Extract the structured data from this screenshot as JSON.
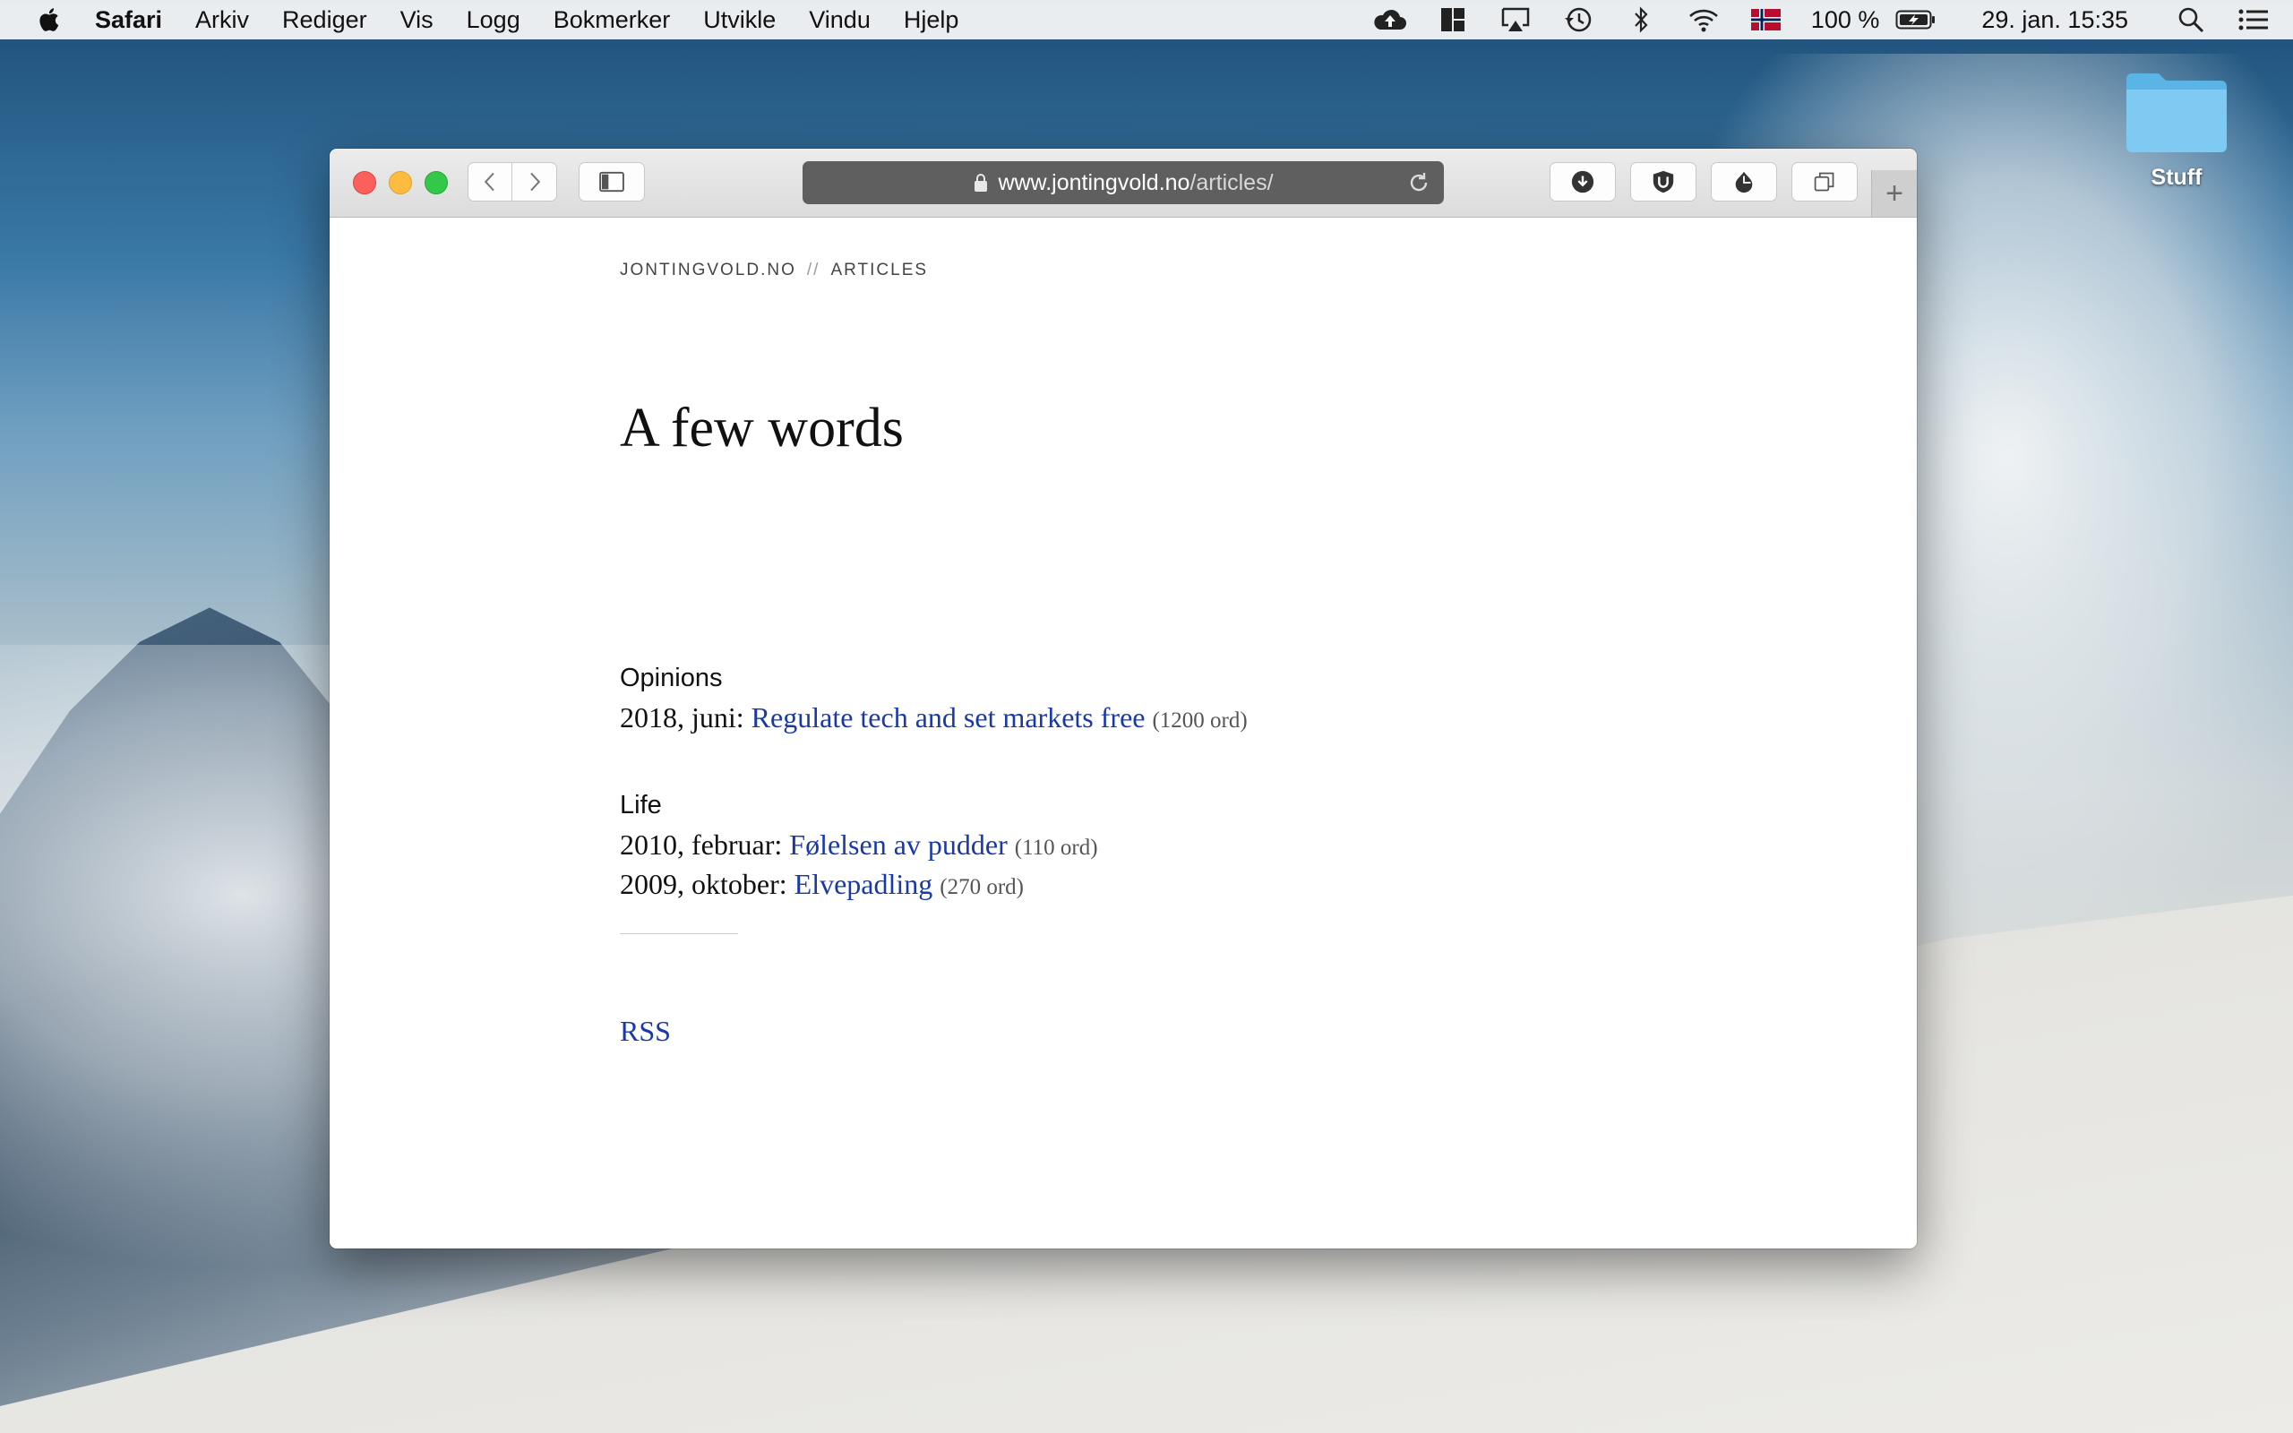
{
  "menubar": {
    "app_name": "Safari",
    "items": [
      "Arkiv",
      "Rediger",
      "Vis",
      "Logg",
      "Bokmerker",
      "Utvikle",
      "Vindu",
      "Hjelp"
    ],
    "battery": "100 %",
    "clock": "29. jan.  15:35",
    "status_icons": [
      "cloud-upload-icon",
      "layout-icon",
      "airplay-icon",
      "time-machine-icon",
      "bluetooth-icon",
      "wifi-icon",
      "norwegian-flag-icon",
      "battery-icon",
      "spotlight-icon",
      "notification-center-icon"
    ]
  },
  "desktop": {
    "folder_label": "Stuff"
  },
  "browser": {
    "url_host": "www.jontingvold.no",
    "url_path": "/articles/",
    "toolbar_icons": [
      "back-icon",
      "forward-icon",
      "sidebar-icon",
      "download-icon",
      "extension-u-icon",
      "extension-drop-icon",
      "tabs-overview-icon",
      "new-tab-icon"
    ]
  },
  "page": {
    "breadcrumb": {
      "site": "JONTINGVOLD.NO",
      "separator": "//",
      "section": "ARTICLES"
    },
    "title": "A few words",
    "sections": [
      {
        "heading": "Opinions",
        "entries": [
          {
            "date": "2018, juni:",
            "title": "Regulate tech and set markets free",
            "count": "(1200 ord)"
          }
        ]
      },
      {
        "heading": "Life",
        "entries": [
          {
            "date": "2010, februar:",
            "title": "Følelsen av pudder",
            "count": "(110 ord)"
          },
          {
            "date": "2009, oktober:",
            "title": "Elvepadling",
            "count": "(270 ord)"
          }
        ]
      }
    ],
    "rss_label": "RSS"
  },
  "colors": {
    "link": "#1a39a8",
    "urlbar_bg": "#5f5f5f",
    "close": "#fc605c",
    "minimize": "#fdbc40",
    "maximize": "#34c84a"
  }
}
